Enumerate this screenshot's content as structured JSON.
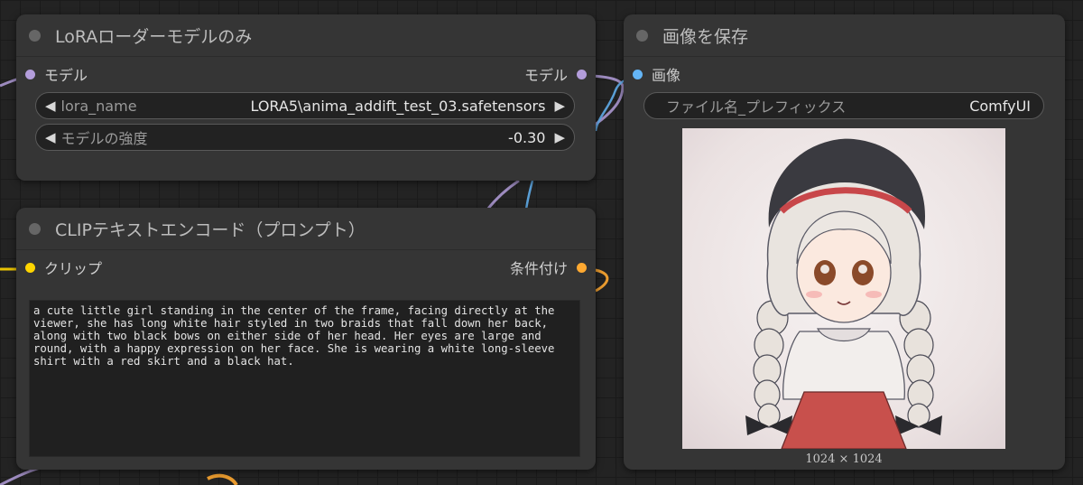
{
  "colors": {
    "model": "#b39ddb",
    "image": "#64b5f6",
    "clip": "#ffd500",
    "conditioning": "#ffa931"
  },
  "lora_node": {
    "title": "LoRAローダーモデルのみ",
    "input_label": "モデル",
    "output_label": "モデル",
    "widgets": [
      {
        "label": "lora_name",
        "value": "LORA5\\anima_addift_test_03.safetensors"
      },
      {
        "label": "モデルの強度",
        "value": "-0.30"
      }
    ],
    "arrow_left": "◀",
    "arrow_right": "▶"
  },
  "clip_node": {
    "title": "CLIPテキストエンコード（プロンプト）",
    "input_label": "クリップ",
    "output_label": "条件付け",
    "prompt_text": "a cute little girl standing in the center of the frame, facing directly at the viewer, she has long white hair styled in two braids that fall down her back, along with two black bows on either side of her head. Her eyes are large and round, with a happy expression on her face. She is wearing a white long-sleeve shirt with a red skirt and a black hat."
  },
  "save_node": {
    "title": "画像を保存",
    "input_label": "画像",
    "prefix_label": "ファイル名_プレフィックス",
    "prefix_value": "ComfyUI",
    "image_size": "1024 × 1024"
  }
}
